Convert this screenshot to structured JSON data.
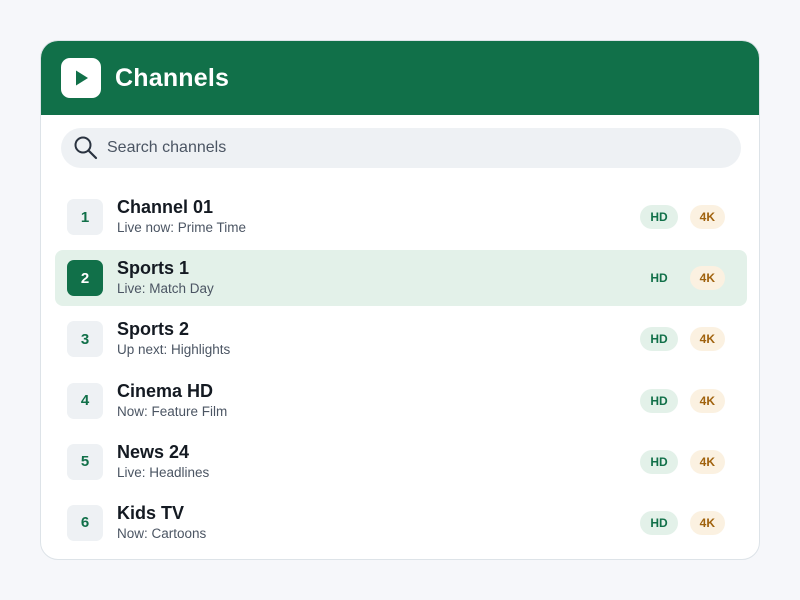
{
  "header": {
    "title": "Channels",
    "logo_icon": "play-icon"
  },
  "search": {
    "placeholder": "Search channels",
    "value": "",
    "icon": "search-icon"
  },
  "colors": {
    "brand": "#117049",
    "selected_row": "#e3f1e9",
    "hd_badge_text": "#117049",
    "k4_badge_text": "#a0620d"
  },
  "channels": [
    {
      "number": "1",
      "name": "Channel 01",
      "subtitle": "Live now: Prime Time",
      "badges": [
        "HD",
        "4K"
      ],
      "selected": false
    },
    {
      "number": "2",
      "name": "Sports 1",
      "subtitle": "Live: Match Day",
      "badges": [
        "HD",
        "4K"
      ],
      "selected": true
    },
    {
      "number": "3",
      "name": "Sports 2",
      "subtitle": "Up next: Highlights",
      "badges": [
        "HD",
        "4K"
      ],
      "selected": false
    },
    {
      "number": "4",
      "name": "Cinema HD",
      "subtitle": "Now: Feature Film",
      "badges": [
        "HD",
        "4K"
      ],
      "selected": false
    },
    {
      "number": "5",
      "name": "News 24",
      "subtitle": "Live: Headlines",
      "badges": [
        "HD",
        "4K"
      ],
      "selected": false
    },
    {
      "number": "6",
      "name": "Kids TV",
      "subtitle": "Now: Cartoons",
      "badges": [
        "HD",
        "4K"
      ],
      "selected": false
    }
  ]
}
